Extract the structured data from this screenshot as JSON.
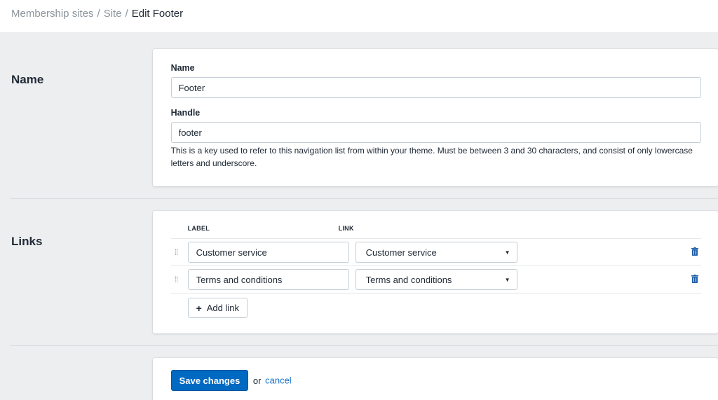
{
  "breadcrumb": {
    "items": [
      "Membership sites",
      "Site"
    ],
    "separator": "/",
    "current": "Edit Footer"
  },
  "name_section": {
    "title": "Name",
    "name_label": "Name",
    "name_value": "Footer",
    "handle_label": "Handle",
    "handle_value": "footer",
    "handle_help": "This is a key used to refer to this navigation list from within your theme. Must be between 3 and 30 characters, and consist of only lowercase letters and underscore."
  },
  "links_section": {
    "title": "Links",
    "label_header": "LABEL",
    "link_header": "LINK",
    "rows": [
      {
        "label": "Customer service",
        "link": "Customer service"
      },
      {
        "label": "Terms and conditions",
        "link": "Terms and conditions"
      }
    ],
    "add_link_label": "Add link"
  },
  "actions": {
    "save_label": "Save changes",
    "or_text": "or",
    "cancel_label": "cancel"
  },
  "colors": {
    "primary_button": "#0069c2",
    "link": "#1470c7",
    "background": "#eceef0"
  },
  "icons": {
    "drag": "drag-handle-icon",
    "trash": "trash-icon",
    "plus": "plus-icon",
    "caret": "caret-down-icon"
  }
}
